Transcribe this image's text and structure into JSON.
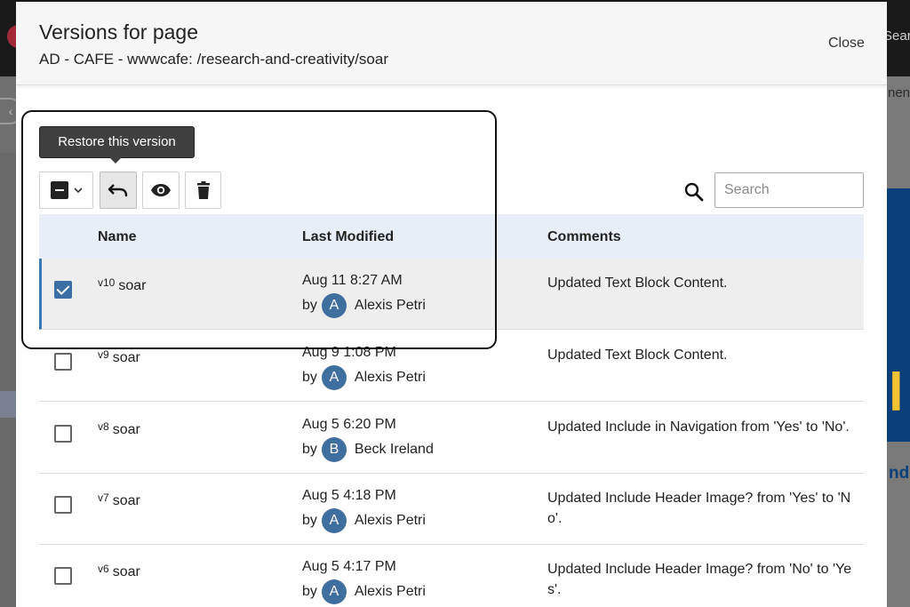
{
  "background": {
    "search_text": "Sear",
    "menu_text": "nent",
    "hero_text": "l",
    "link_text": "nd L"
  },
  "modal": {
    "title": "Versions for page",
    "subtitle": "AD - CAFE - wwwcafe: /research-and-creativity/soar",
    "close_label": "Close"
  },
  "toolbar": {
    "tooltip": "Restore this version",
    "select_icon": "checkbox-minus-icon",
    "restore_icon": "undo-icon",
    "preview_icon": "eye-icon",
    "delete_icon": "trash-icon"
  },
  "search": {
    "placeholder": "Search",
    "value": ""
  },
  "table": {
    "headers": {
      "name": "Name",
      "modified": "Last Modified",
      "comments": "Comments"
    },
    "by_label": "by",
    "rows": [
      {
        "version": "v10",
        "name": "soar",
        "date": "Aug 11 8:27 AM",
        "initial": "A",
        "user": "Alexis Petri",
        "comment": "Updated Text Block Content.",
        "checked": true
      },
      {
        "version": "v9",
        "name": "soar",
        "date": "Aug 9 1:08 PM",
        "initial": "A",
        "user": "Alexis Petri",
        "comment": "Updated Text Block Content.",
        "checked": false
      },
      {
        "version": "v8",
        "name": "soar",
        "date": "Aug 5 6:20 PM",
        "initial": "B",
        "user": "Beck Ireland",
        "comment": "Updated Include in Navigation from 'Yes' to 'No'.",
        "checked": false
      },
      {
        "version": "v7",
        "name": "soar",
        "date": "Aug 5 4:18 PM",
        "initial": "A",
        "user": "Alexis Petri",
        "comment": "Updated Include Header Image? from 'Yes' to 'No'.",
        "checked": false
      },
      {
        "version": "v6",
        "name": "soar",
        "date": "Aug 5 4:17 PM",
        "initial": "A",
        "user": "Alexis Petri",
        "comment": "Updated Include Header Image? from 'No' to 'Yes'.",
        "checked": false
      }
    ]
  },
  "colors": {
    "accent": "#3a6ea5",
    "avatar": "#3f6f9e",
    "header_row": "#e8eef7",
    "selected_row": "#eeeeee"
  }
}
